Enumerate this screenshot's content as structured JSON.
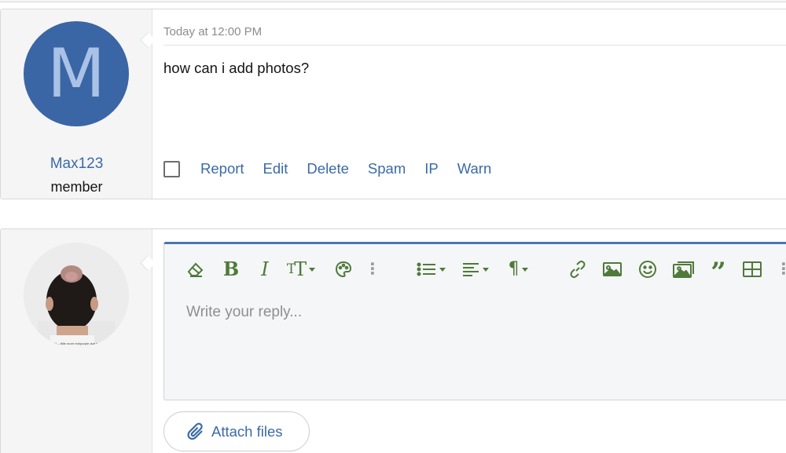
{
  "message": {
    "avatar_letter": "M",
    "username": "Max123",
    "user_title": "member",
    "timestamp": "Today at 12:00 PM",
    "body": "how can i add photos?",
    "actions": [
      "Report",
      "Edit",
      "Delete",
      "Spam",
      "IP",
      "Warn"
    ]
  },
  "reply": {
    "avatar_caption": "*1 – little more red/purple due to",
    "toolbar_buttons": [
      "clear-formatting",
      "bold",
      "italic",
      "font-size",
      "text-color",
      "more-text",
      "list",
      "align",
      "paragraph-format",
      "link",
      "insert-image",
      "insert-smilie",
      "insert-media",
      "quote",
      "insert-table",
      "more-rich"
    ],
    "placeholder": "Write your reply...",
    "attach_label": "Attach files"
  },
  "colors": {
    "avatar_bg": "#3b66a5",
    "link": "#3b6aa8",
    "toolbar_icon": "#4f7a3a",
    "editor_accent": "#4a76b0"
  }
}
